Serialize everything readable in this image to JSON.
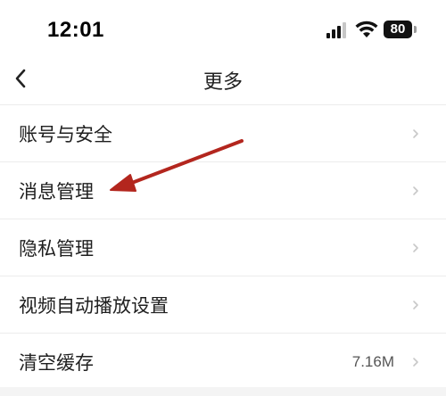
{
  "status_bar": {
    "time": "12:01",
    "battery_level": "80",
    "icons": [
      "signal-icon",
      "wifi-icon",
      "battery-icon"
    ]
  },
  "nav": {
    "title": "更多",
    "back_icon": "chevron-left-icon"
  },
  "settings": {
    "items": [
      {
        "label": "账号与安全",
        "value": ""
      },
      {
        "label": "消息管理",
        "value": ""
      },
      {
        "label": "隐私管理",
        "value": ""
      },
      {
        "label": "视频自动播放设置",
        "value": ""
      },
      {
        "label": "清空缓存",
        "value": "7.16M"
      }
    ]
  },
  "annotation": {
    "color": "#b3261e",
    "points_to": "消息管理"
  },
  "colors": {
    "background": "#ffffff",
    "divider": "#ececec",
    "page_bottom": "#f4f4f4",
    "chevron": "#c8c8c8"
  }
}
